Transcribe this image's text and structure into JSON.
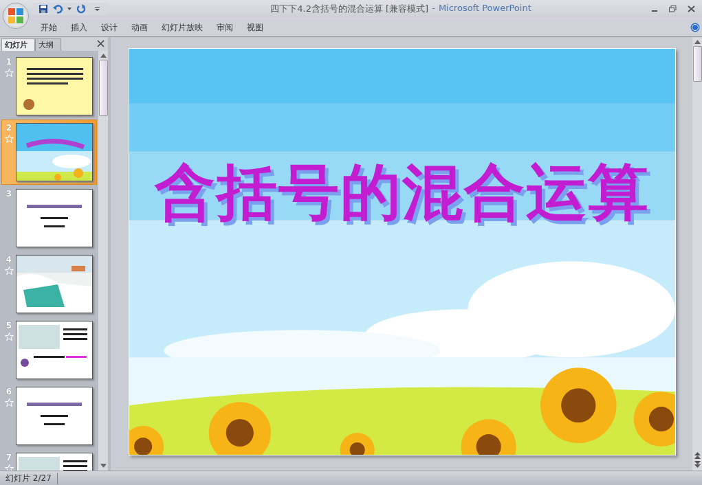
{
  "window": {
    "document": "四下下4.2含括号的混合运算 [兼容模式]",
    "separator": "-",
    "app": "Microsoft PowerPoint"
  },
  "ribbon_tabs": [
    {
      "label": "开始"
    },
    {
      "label": "插入"
    },
    {
      "label": "设计"
    },
    {
      "label": "动画"
    },
    {
      "label": "幻灯片放映"
    },
    {
      "label": "审阅"
    },
    {
      "label": "视图"
    }
  ],
  "panel_tabs": [
    {
      "label": "幻灯片",
      "selected": true
    },
    {
      "label": "大纲",
      "selected": false
    }
  ],
  "slides": [
    {
      "number": "1",
      "selected": false,
      "animated": true,
      "kind": "note"
    },
    {
      "number": "2",
      "selected": true,
      "animated": true,
      "kind": "title"
    },
    {
      "number": "3",
      "selected": false,
      "animated": false,
      "kind": "plain"
    },
    {
      "number": "4",
      "selected": false,
      "animated": true,
      "kind": "scene"
    },
    {
      "number": "5",
      "selected": false,
      "animated": true,
      "kind": "lesson"
    },
    {
      "number": "6",
      "selected": false,
      "animated": true,
      "kind": "plain"
    },
    {
      "number": "7",
      "selected": false,
      "animated": true,
      "kind": "lesson"
    }
  ],
  "slide": {
    "title": "含括号的混合运算"
  },
  "status_bar": {
    "slide_indicator": "幻灯片 2/27"
  }
}
